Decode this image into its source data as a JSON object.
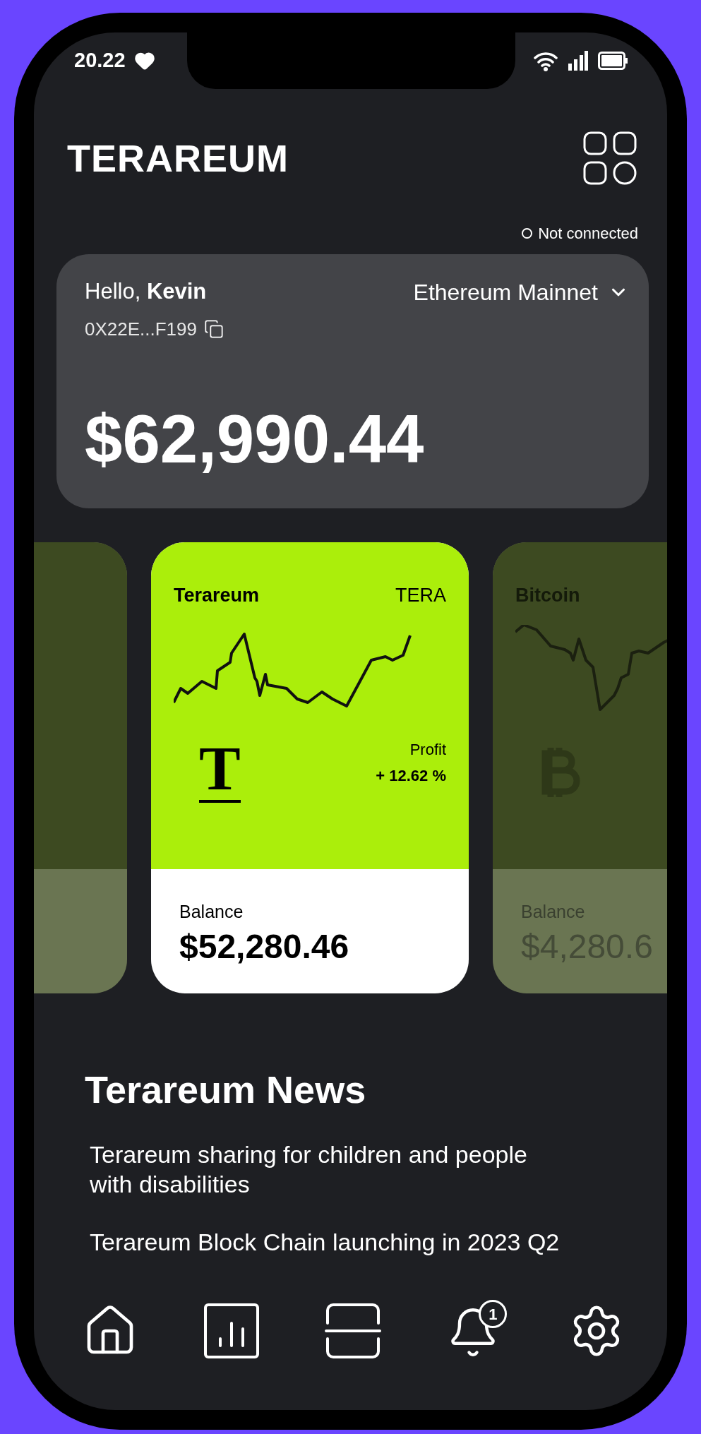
{
  "status_bar": {
    "time": "20.22"
  },
  "header": {
    "title": "TERAREUM"
  },
  "connection": {
    "label": "Not connected",
    "connected": false
  },
  "wallet": {
    "greeting": "Hello, **Kevin**",
    "address": "0X22E...F199",
    "network": "Ethereum Mainnet",
    "total": "$62,990.44"
  },
  "cards": [
    {
      "selected": false
    },
    {
      "selected": true,
      "name": "Terareum",
      "ticker": "TERA",
      "kind": "letter",
      "logo": "T",
      "profit_label": "Profit",
      "profit": "+ 12.62 %",
      "balance_label": "Balance",
      "balance": "$52,280.46"
    },
    {
      "selected": false,
      "name": "Bitcoin",
      "kind": "bitcoin",
      "balance_label": "Balance",
      "balance": "$4,280.6"
    }
  ],
  "news": {
    "title": "Terareum News",
    "items": [
      "Terareum sharing for children and people with disabilities",
      "Terareum Block Chain launching in 2023 Q2"
    ]
  },
  "nav": {
    "notification_count": "1"
  }
}
